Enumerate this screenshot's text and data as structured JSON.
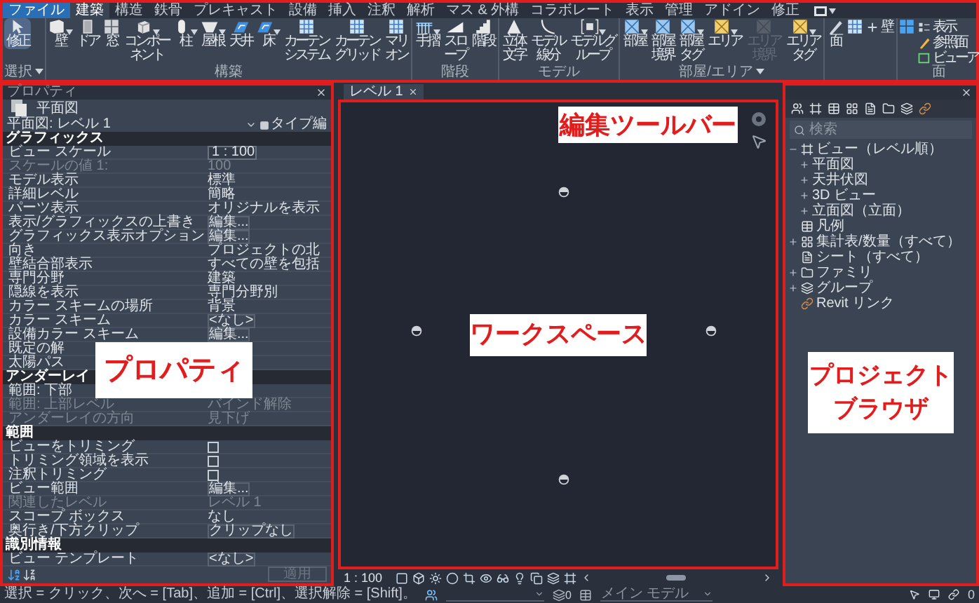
{
  "ribbon": {
    "tabs": [
      {
        "label": "ファイル",
        "kind": "file",
        "selected": false
      },
      {
        "label": "建築",
        "kind": "tab",
        "selected": true
      },
      {
        "label": "構造",
        "kind": "tab",
        "selected": false
      },
      {
        "label": "鉄骨",
        "kind": "tab",
        "selected": false
      },
      {
        "label": "プレキャスト",
        "kind": "tab",
        "selected": false
      },
      {
        "label": "設備",
        "kind": "tab",
        "selected": false
      },
      {
        "label": "挿入",
        "kind": "tab",
        "selected": false
      },
      {
        "label": "注釈",
        "kind": "tab",
        "selected": false
      },
      {
        "label": "解析",
        "kind": "tab",
        "selected": false
      },
      {
        "label": "マス & 外構",
        "kind": "tab",
        "selected": false
      },
      {
        "label": "コラボレート",
        "kind": "tab",
        "selected": false
      },
      {
        "label": "表示",
        "kind": "tab",
        "selected": false
      },
      {
        "label": "管理",
        "kind": "tab",
        "selected": false
      },
      {
        "label": "アドイン",
        "kind": "tab",
        "selected": false
      },
      {
        "label": "修正",
        "kind": "tab",
        "selected": false
      }
    ],
    "panels": [
      {
        "label": "選択",
        "menu": true,
        "buttons": [
          {
            "kind": "large",
            "label": "修正",
            "dropdown": false,
            "disabled": false,
            "selected": true
          }
        ]
      },
      {
        "label": "構築",
        "menu": false,
        "buttons": [
          {
            "kind": "large",
            "label": "壁",
            "dropdown": true,
            "disabled": false,
            "selected": false
          },
          {
            "kind": "large",
            "label": "ドア",
            "dropdown": false,
            "disabled": false,
            "selected": false
          },
          {
            "kind": "large",
            "label": "窓",
            "dropdown": false,
            "disabled": false,
            "selected": false
          },
          {
            "kind": "large",
            "label": "コンポーネント",
            "dropdown": true,
            "disabled": false,
            "selected": false
          },
          {
            "kind": "large",
            "label": "柱",
            "dropdown": true,
            "disabled": false,
            "selected": false
          },
          {
            "kind": "large",
            "label": "屋根",
            "dropdown": true,
            "disabled": false,
            "selected": false
          },
          {
            "kind": "large",
            "label": "天井",
            "dropdown": false,
            "disabled": false,
            "selected": false
          },
          {
            "kind": "large",
            "label": "床",
            "dropdown": true,
            "disabled": false,
            "selected": false
          },
          {
            "kind": "large",
            "label": "カーテンシステム",
            "dropdown": false,
            "disabled": false,
            "selected": false
          },
          {
            "kind": "large",
            "label": "カーテングリッド",
            "dropdown": false,
            "disabled": false,
            "selected": false
          },
          {
            "kind": "large",
            "label": "マリオン",
            "dropdown": false,
            "disabled": false,
            "selected": false
          }
        ]
      },
      {
        "label": "階段",
        "menu": false,
        "buttons": [
          {
            "kind": "large",
            "label": "手摺",
            "dropdown": true,
            "disabled": false,
            "selected": false
          },
          {
            "kind": "large",
            "label": "スロープ",
            "dropdown": false,
            "disabled": false,
            "selected": false
          },
          {
            "kind": "large",
            "label": "階段",
            "dropdown": false,
            "disabled": false,
            "selected": false
          }
        ]
      },
      {
        "label": "モデル",
        "menu": false,
        "buttons": [
          {
            "kind": "large",
            "label": "立体文字",
            "dropdown": false,
            "disabled": false,
            "selected": false
          },
          {
            "kind": "large",
            "label": "モデル線分",
            "dropdown": false,
            "disabled": false,
            "selected": false
          },
          {
            "kind": "large",
            "label": "モデルグループ",
            "dropdown": true,
            "disabled": false,
            "selected": false
          }
        ]
      },
      {
        "label": "部屋/エリア",
        "menu": true,
        "buttons": [
          {
            "kind": "large",
            "label": "部屋",
            "dropdown": true,
            "disabled": false,
            "selected": false
          },
          {
            "kind": "large",
            "label": "部屋境界",
            "dropdown": false,
            "disabled": false,
            "selected": false
          },
          {
            "kind": "large",
            "label": "部屋タグ",
            "dropdown": true,
            "disabled": false,
            "selected": false
          },
          {
            "kind": "large",
            "label": "エリア",
            "dropdown": true,
            "disabled": false,
            "selected": false
          },
          {
            "kind": "large",
            "label": "エリア境界",
            "dropdown": false,
            "disabled": true,
            "selected": false
          },
          {
            "kind": "large",
            "label": "エリアタグ",
            "dropdown": true,
            "disabled": false,
            "selected": false
          }
        ]
      },
      {
        "buttons": [
          {
            "kind": "large",
            "label": "面",
            "dropdown": false,
            "disabled": false,
            "selected": false
          },
          {
            "kind": "large",
            "dropdown": false,
            "disabled": false,
            "selected": false
          },
          {
            "kind": "small",
            "label": "壁",
            "dropdown": false,
            "disabled": false,
            "selected": false
          }
        ]
      },
      {
        "label": "面",
        "menu": false,
        "buttons": [
          {
            "kind": "large",
            "dropdown": false,
            "disabled": false,
            "selected": false
          },
          {
            "kind": "small",
            "label": "表示",
            "dropdown": false,
            "disabled": false,
            "selected": false
          },
          {
            "kind": "small",
            "label": "参照面",
            "dropdown": false,
            "disabled": false,
            "selected": false
          },
          {
            "kind": "small",
            "label": "ビューア",
            "dropdown": false,
            "disabled": false,
            "selected": false
          }
        ]
      }
    ],
    "annotation": "編集ツールバー"
  },
  "properties": {
    "title": "プロパティ",
    "type_name": "平面図",
    "instance": "平面図: レベル 1",
    "edit_type": "タイプ編",
    "rows": [
      {
        "kind": "section",
        "label": "グラフィックス"
      },
      {
        "kind": "field",
        "label": "ビュー スケール",
        "value": "1 : 100",
        "disabled": false
      },
      {
        "kind": "text",
        "label": "スケールの値 1:",
        "value": "100",
        "disabled": true
      },
      {
        "kind": "text",
        "label": "モデル表示",
        "value": "標準",
        "disabled": false
      },
      {
        "kind": "text",
        "label": "詳細レベル",
        "value": "簡略",
        "disabled": false
      },
      {
        "kind": "text",
        "label": "パーツ表示",
        "value": "オリジナルを表示",
        "disabled": false
      },
      {
        "kind": "button",
        "label": "表示/グラフィックスの上書き",
        "value": "編集...",
        "disabled": false
      },
      {
        "kind": "button",
        "label": "グラフィックス表示オプション",
        "value": "編集...",
        "disabled": false
      },
      {
        "kind": "text",
        "label": "向き",
        "value": "プロジェクトの北",
        "disabled": false
      },
      {
        "kind": "text",
        "label": "壁結合部表示",
        "value": "すべての壁を包括",
        "disabled": false
      },
      {
        "kind": "text",
        "label": "専門分野",
        "value": "建築",
        "disabled": false
      },
      {
        "kind": "text",
        "label": "隠線を表示",
        "value": "専門分野別",
        "disabled": false
      },
      {
        "kind": "text",
        "label": "カラー スキームの場所",
        "value": "背景",
        "disabled": false
      },
      {
        "kind": "button",
        "label": "カラー スキーム",
        "value": "<なし>",
        "disabled": false
      },
      {
        "kind": "button",
        "label": "設備カラー スキーム",
        "value": "編集...",
        "disabled": false
      },
      {
        "kind": "text",
        "label": "既定の解",
        "disabled": false
      },
      {
        "kind": "text",
        "label": "太陽パス",
        "disabled": false
      },
      {
        "kind": "section",
        "label": "アンダーレイ"
      },
      {
        "kind": "text",
        "label": "範囲: 下部",
        "disabled": false
      },
      {
        "kind": "text",
        "label": "範囲: 上部レベル",
        "value": "バインド解除",
        "disabled": true
      },
      {
        "kind": "text",
        "label": "アンダーレイの方向",
        "value": "見下げ",
        "disabled": true
      },
      {
        "kind": "section",
        "label": "範囲"
      },
      {
        "kind": "check",
        "label": "ビューをトリミング",
        "checked": false,
        "disabled": false
      },
      {
        "kind": "check",
        "label": "トリミング領域を表示",
        "checked": false,
        "disabled": false
      },
      {
        "kind": "check",
        "label": "注釈トリミング",
        "checked": false,
        "disabled": false
      },
      {
        "kind": "button",
        "label": "ビュー範囲",
        "value": "編集...",
        "disabled": false
      },
      {
        "kind": "text",
        "label": "関連したレベル",
        "value": "レベル 1",
        "disabled": true
      },
      {
        "kind": "text",
        "label": "スコープ ボックス",
        "value": "なし",
        "disabled": false
      },
      {
        "kind": "button",
        "label": "奥行き/下方クリップ",
        "value": "クリップなし",
        "disabled": false
      },
      {
        "kind": "section",
        "label": "識別情報"
      },
      {
        "kind": "button",
        "label": "ビュー テンプレート",
        "value": "<なし>",
        "disabled": false
      }
    ],
    "apply": {
      "label": "適用",
      "disabled": true
    },
    "annotation": "プロパティ"
  },
  "view": {
    "tab": "レベル 1",
    "scale": "1 : 100",
    "annotation": "ワークスペース"
  },
  "browser": {
    "search_placeholder": "検索",
    "tree": [
      {
        "label": "ビュー（レベル順）",
        "expanded": true,
        "children": [
          {
            "label": "平面図",
            "expanded": false
          },
          {
            "label": "天井伏図",
            "expanded": false
          },
          {
            "label": "3D ビュー",
            "expanded": false
          },
          {
            "label": "立面図（立面）",
            "expanded": false
          }
        ]
      },
      {
        "label": "凡例"
      },
      {
        "label": "集計表/数量（すべて）",
        "expanded": false
      },
      {
        "label": "シート（すべて）"
      },
      {
        "label": "ファミリ",
        "expanded": false
      },
      {
        "label": "グループ",
        "expanded": false
      },
      {
        "label": "Revit リンク"
      }
    ],
    "annotation": [
      "プロジェクト",
      "ブラウザ"
    ]
  },
  "status": {
    "hint": "選択 = クリック、次へ = [Tab]、追加 = [Ctrl]、選択解除 = [Shift]。",
    "workset_count": "0",
    "model": "メイン モデル",
    "filter_count": "0"
  }
}
